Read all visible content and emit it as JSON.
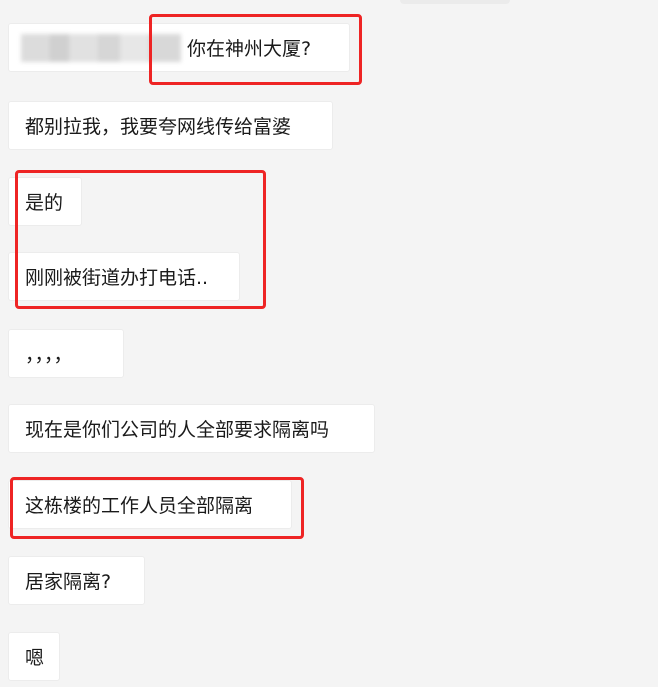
{
  "messages": [
    {
      "text": "你在神州大厦?"
    },
    {
      "text": "都别拉我，我要夸网线传给富婆"
    },
    {
      "text": "是的"
    },
    {
      "text": "刚刚被街道办打电话.."
    },
    {
      "text": "，，，，"
    },
    {
      "text": "现在是你们公司的人全部要求隔离吗"
    },
    {
      "text": "这栋楼的工作人员全部隔离"
    },
    {
      "text": "居家隔离?"
    },
    {
      "text": "嗯"
    }
  ],
  "colors": {
    "background": "#f4f4f4",
    "bubble": "#ffffff",
    "highlight": "#ee2424"
  }
}
